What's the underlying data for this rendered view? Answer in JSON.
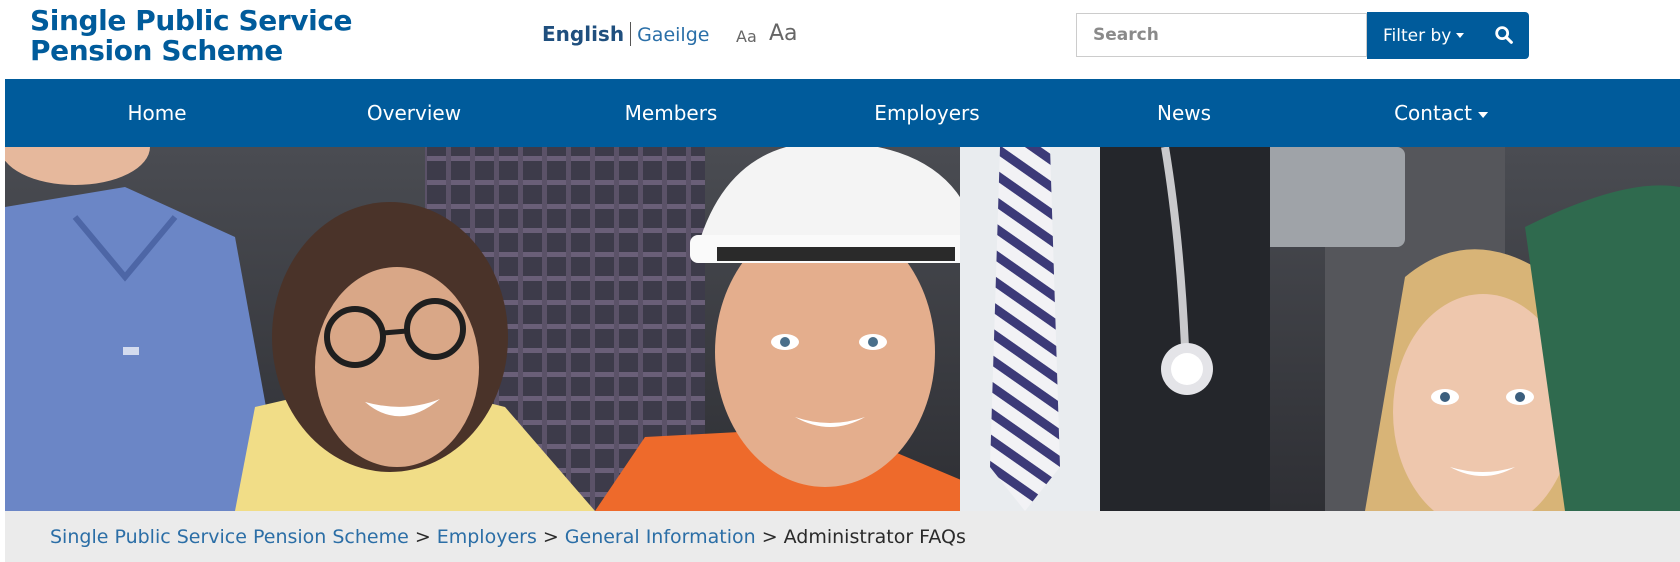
{
  "header": {
    "logo_line1": "Single Public Service",
    "logo_line2": "Pension Scheme",
    "language": {
      "english": "English",
      "irish": "Gaeilge"
    },
    "text_size": {
      "small": "Aa",
      "large": "Aa"
    },
    "search": {
      "placeholder": "Search",
      "filter_label": "Filter by"
    }
  },
  "nav": {
    "items": [
      {
        "label": "Home"
      },
      {
        "label": "Overview"
      },
      {
        "label": "Members"
      },
      {
        "label": "Employers"
      },
      {
        "label": "News"
      },
      {
        "label": "Contact"
      }
    ]
  },
  "hero": {
    "icon": "people-photo-banner"
  },
  "breadcrumb": {
    "items": [
      {
        "label": "Single Public Service Pension Scheme"
      },
      {
        "label": "Employers"
      },
      {
        "label": "General Information"
      }
    ],
    "current": "Administrator FAQs",
    "separator": ">"
  },
  "colors": {
    "brand_blue": "#005b9b",
    "link_blue": "#2b6ea6",
    "breadcrumb_bg": "#ebebeb"
  }
}
